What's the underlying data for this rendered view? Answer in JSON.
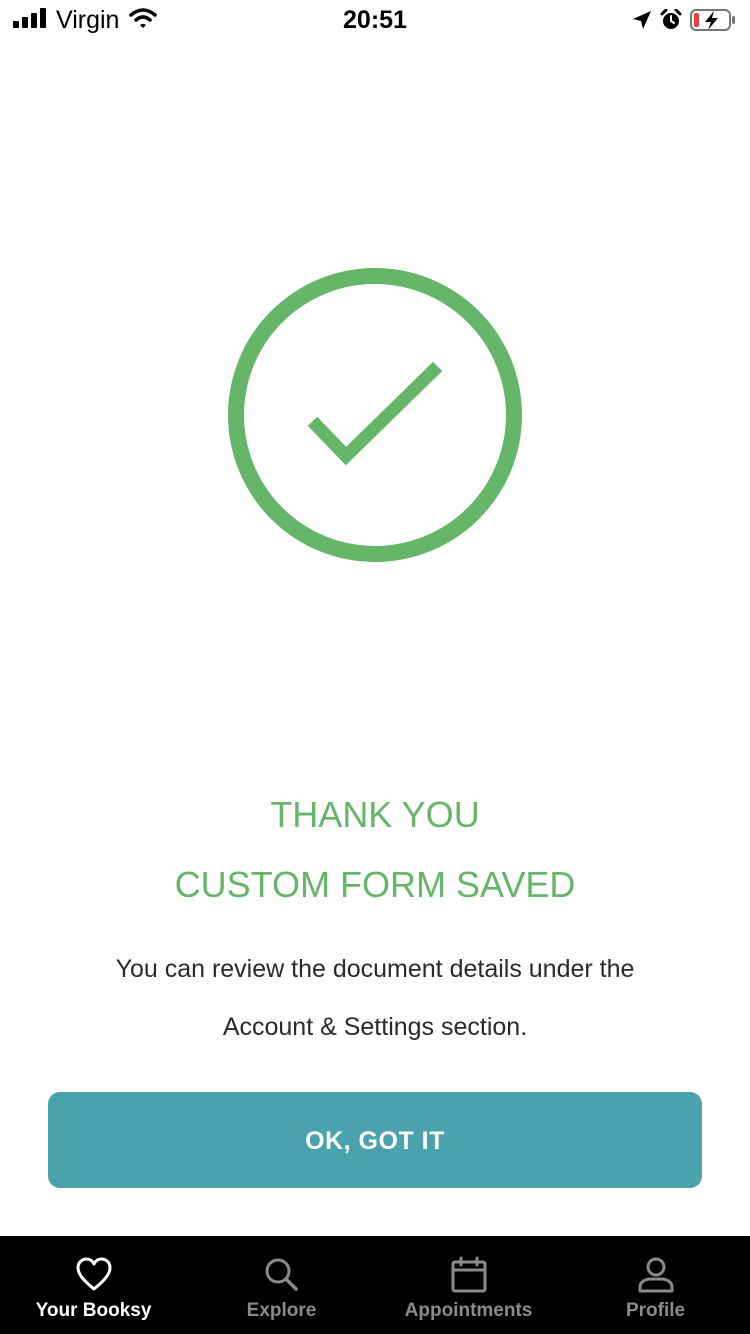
{
  "status_bar": {
    "carrier": "Virgin",
    "time": "20:51",
    "icons": [
      "signal-icon",
      "wifi-icon",
      "location-arrow-icon",
      "alarm-icon",
      "battery-charging-icon"
    ]
  },
  "success": {
    "icon": "check-circle-icon",
    "title_line_1": "THANK YOU",
    "title_line_2": "CUSTOM FORM SAVED",
    "message_line_1": "You can review the document details under the",
    "message_line_2": "Account & Settings section.",
    "button_label": "OK, GOT IT"
  },
  "tab_bar": {
    "active_tab": "Your Booksy",
    "tabs": [
      {
        "label": "Your Booksy",
        "icon": "heart-icon"
      },
      {
        "label": "Explore",
        "icon": "search-icon"
      },
      {
        "label": "Appointments",
        "icon": "calendar-icon"
      },
      {
        "label": "Profile",
        "icon": "person-icon"
      }
    ]
  },
  "colors": {
    "accent_green": "#66b66a",
    "button_teal": "#4aa3ac",
    "tab_bar_bg": "#000000",
    "tab_inactive": "#8a8a8a",
    "tab_active": "#ffffff"
  }
}
